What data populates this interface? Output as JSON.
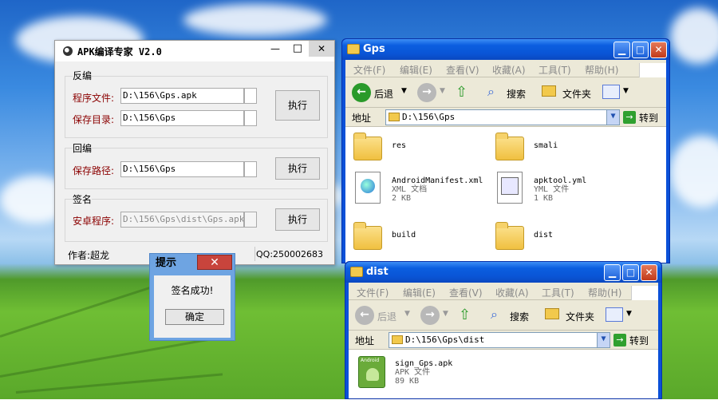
{
  "apk": {
    "title": "APK编译专家 V2.0",
    "minimize": "—",
    "maximize": "□",
    "close": "✕",
    "decompile": {
      "group": "反编",
      "file_label": "程序文件:",
      "file_value": "D:\\156\\Gps.apk",
      "save_label": "保存目录:",
      "save_value": "D:\\156\\Gps",
      "exec": "执行"
    },
    "recompile": {
      "group": "回编",
      "path_label": "保存路径:",
      "path_value": "D:\\156\\Gps",
      "exec": "执行"
    },
    "sign": {
      "group": "签名",
      "app_label": "安卓程序:",
      "app_value": "D:\\156\\Gps\\dist\\Gps.apk",
      "exec": "执行"
    },
    "author": "作者:超龙",
    "qq": "QQ:250002683"
  },
  "msgbox": {
    "title": "提示",
    "close": "✕",
    "text": "签名成功!",
    "ok": "确定"
  },
  "explorer1": {
    "title": "Gps",
    "menu": [
      "文件(F)",
      "编辑(E)",
      "查看(V)",
      "收藏(A)",
      "工具(T)",
      "帮助(H)"
    ],
    "back": "后退",
    "search": "搜索",
    "folders": "文件夹",
    "address_label": "地址",
    "address": "D:\\156\\Gps",
    "go": "转到",
    "items": [
      {
        "name": "res",
        "type": "",
        "size": ""
      },
      {
        "name": "smali",
        "type": "",
        "size": ""
      },
      {
        "name": "AndroidManifest.xml",
        "type": "XML 文档",
        "size": "2 KB"
      },
      {
        "name": "apktool.yml",
        "type": "YML 文件",
        "size": "1 KB"
      },
      {
        "name": "build",
        "type": "",
        "size": ""
      },
      {
        "name": "dist",
        "type": "",
        "size": ""
      }
    ]
  },
  "explorer2": {
    "title": "dist",
    "menu": [
      "文件(F)",
      "编辑(E)",
      "查看(V)",
      "收藏(A)",
      "工具(T)",
      "帮助(H)"
    ],
    "back": "后退",
    "search": "搜索",
    "folders": "文件夹",
    "address_label": "地址",
    "address": "D:\\156\\Gps\\dist",
    "go": "转到",
    "items": [
      {
        "name": "sign_Gps.apk",
        "type": "APK 文件",
        "size": "89 KB",
        "icon_text": "Android"
      }
    ]
  },
  "colors": {
    "label_red": "#8b0000",
    "xp_blue": "#0a50d8"
  }
}
